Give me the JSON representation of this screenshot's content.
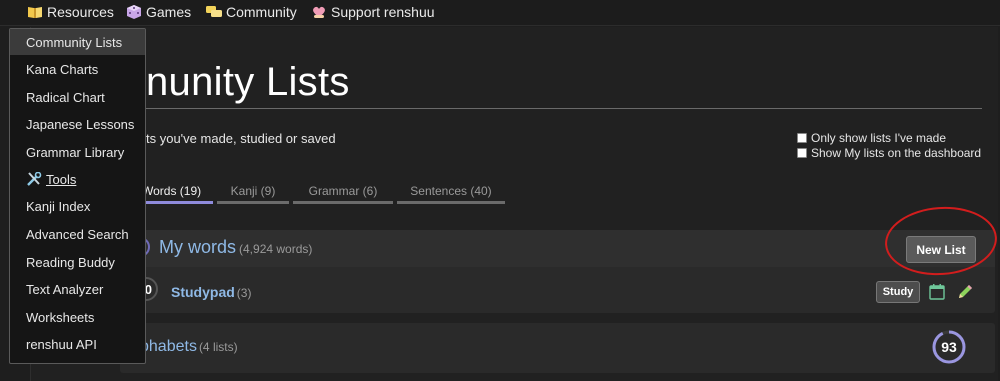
{
  "nav": {
    "items": [
      {
        "label": "Resources",
        "icon": "book-icon"
      },
      {
        "label": "Games",
        "icon": "dice-icon"
      },
      {
        "label": "Community",
        "icon": "chat-bubbles-icon"
      },
      {
        "label": "Support renshuu",
        "icon": "heart-hands-icon"
      }
    ]
  },
  "dropdown": {
    "items": [
      "Community Lists",
      "Kana Charts",
      "Radical Chart",
      "Japanese Lessons",
      "Grammar Library",
      "Tools",
      "Kanji Index",
      "Advanced Search",
      "Reading Buddy",
      "Text Analyzer",
      "Worksheets",
      "renshuu API"
    ],
    "active": "Community Lists"
  },
  "page": {
    "title": "nunity Lists",
    "subtitle": "ts you've made, studied or saved"
  },
  "options": {
    "only_mine": "Only show lists I've made",
    "show_dashboard": "Show My lists on the dashboard"
  },
  "tabs": [
    "Words (19)",
    "Kanji (9)",
    "Grammar (6)",
    "Sentences (40)"
  ],
  "my_words": {
    "title": "My words",
    "count": "(4,924 words)",
    "new_list_label": "New List"
  },
  "studypad": {
    "badge": "0",
    "name": "Studypad",
    "count": "(3)",
    "study_label": "Study"
  },
  "alphabets": {
    "name": "phabets",
    "count": "(4 lists)",
    "score": "93",
    "score_fraction": 0.93
  },
  "colors": {
    "accent_link": "#8fb9e6",
    "tab_active": "#8f8bdc",
    "annotation_red": "#d21d1d",
    "progress_ring": "#9a96e0"
  }
}
